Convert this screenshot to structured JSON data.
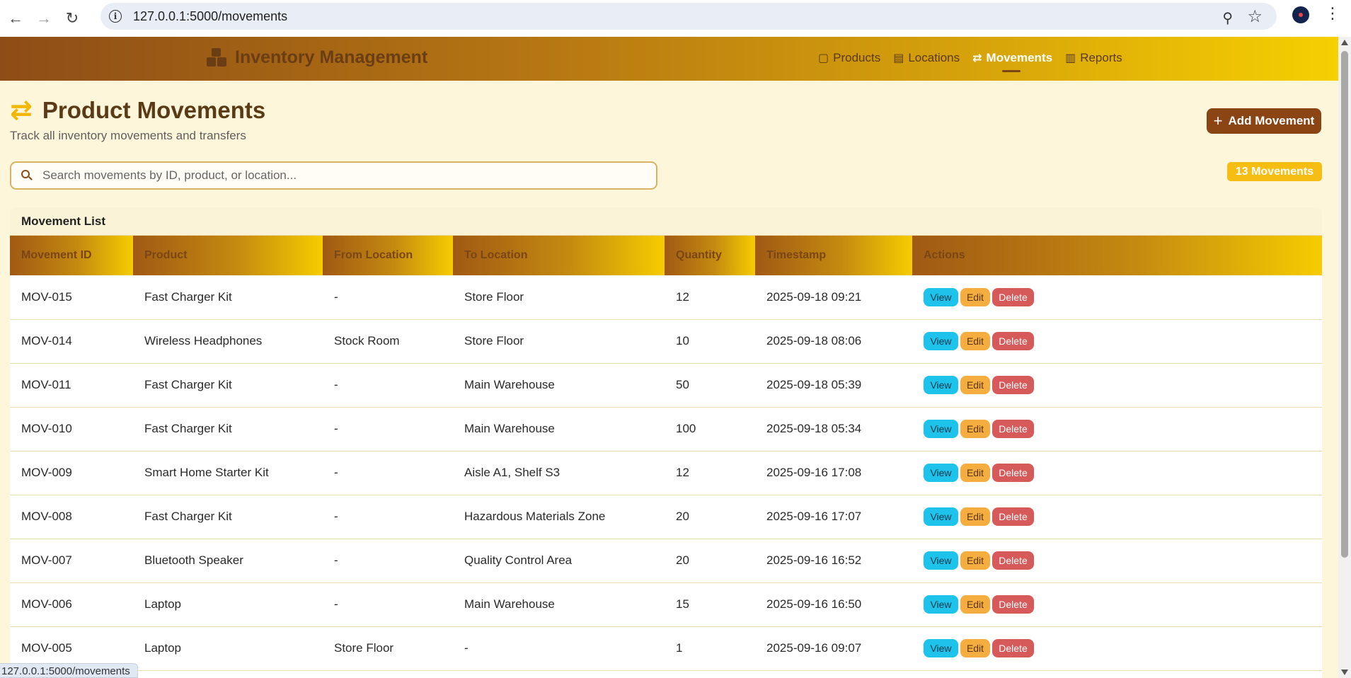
{
  "browser": {
    "url": "127.0.0.1:5000/movements",
    "status_url": "127.0.0.1:5000/movements"
  },
  "nav": {
    "brand": "Inventory Management",
    "links": [
      {
        "label": "Products",
        "icon": "box-icon",
        "active": false
      },
      {
        "label": "Locations",
        "icon": "warehouse-icon",
        "active": false
      },
      {
        "label": "Movements",
        "icon": "exchange-icon",
        "active": true
      },
      {
        "label": "Reports",
        "icon": "chart-icon",
        "active": false
      }
    ]
  },
  "header": {
    "title": "Product Movements",
    "subtitle": "Track all inventory movements and transfers",
    "add_button": "Add Movement"
  },
  "search": {
    "placeholder": "Search movements by ID, product, or location..."
  },
  "count_badge": "13 Movements",
  "table": {
    "title": "Movement List",
    "columns": [
      "Movement ID",
      "Product",
      "From Location",
      "To Location",
      "Quantity",
      "Timestamp",
      "Actions"
    ],
    "action_labels": {
      "view": "View",
      "edit": "Edit",
      "delete": "Delete"
    },
    "rows": [
      {
        "id": "MOV-015",
        "product": "Fast Charger Kit",
        "from": "-",
        "to": "Store Floor",
        "qty": "12",
        "ts": "2025-09-18 09:21"
      },
      {
        "id": "MOV-014",
        "product": "Wireless Headphones",
        "from": "Stock Room",
        "to": "Store Floor",
        "qty": "10",
        "ts": "2025-09-18 08:06"
      },
      {
        "id": "MOV-011",
        "product": "Fast Charger Kit",
        "from": "-",
        "to": "Main Warehouse",
        "qty": "50",
        "ts": "2025-09-18 05:39"
      },
      {
        "id": "MOV-010",
        "product": "Fast Charger Kit",
        "from": "-",
        "to": "Main Warehouse",
        "qty": "100",
        "ts": "2025-09-18 05:34"
      },
      {
        "id": "MOV-009",
        "product": "Smart Home Starter Kit",
        "from": "-",
        "to": "Aisle A1, Shelf S3",
        "qty": "12",
        "ts": "2025-09-16 17:08"
      },
      {
        "id": "MOV-008",
        "product": "Fast Charger Kit",
        "from": "-",
        "to": "Hazardous Materials Zone",
        "qty": "20",
        "ts": "2025-09-16 17:07"
      },
      {
        "id": "MOV-007",
        "product": "Bluetooth Speaker",
        "from": "-",
        "to": "Quality Control Area",
        "qty": "20",
        "ts": "2025-09-16 16:52"
      },
      {
        "id": "MOV-006",
        "product": "Laptop",
        "from": "-",
        "to": "Main Warehouse",
        "qty": "15",
        "ts": "2025-09-16 16:50"
      },
      {
        "id": "MOV-005",
        "product": "Laptop",
        "from": "Store Floor",
        "to": "-",
        "qty": "1",
        "ts": "2025-09-16 09:07"
      }
    ]
  },
  "colors": {
    "accent": "#f2b705",
    "brand_dark": "#8b4414",
    "view": "#1ec3ec",
    "edit": "#f4ad3e",
    "delete": "#d75a5a"
  }
}
